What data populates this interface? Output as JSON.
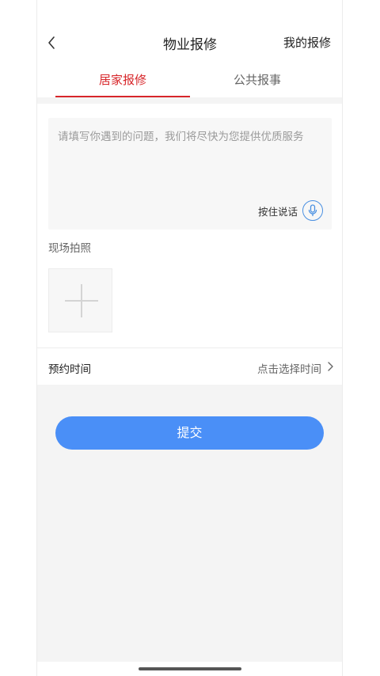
{
  "header": {
    "title": "物业报修",
    "action_label": "我的报修"
  },
  "tabs": [
    {
      "label": "居家报修",
      "active": true
    },
    {
      "label": "公共报事",
      "active": false
    }
  ],
  "form": {
    "description_placeholder": "请填写你遇到的问题，我们将尽快为您提供优质服务",
    "voice_label": "按住说话",
    "photo_label": "现场拍照",
    "appointment_label": "预约时间",
    "appointment_value": "点击选择时间",
    "submit_label": "提交"
  },
  "colors": {
    "accent_red": "#d7262a",
    "primary_blue": "#4a8ff7"
  },
  "icons": {
    "back": "chevron-left-icon",
    "mic": "microphone-icon",
    "add_photo": "plus-icon",
    "row_chevron": "chevron-right-icon"
  }
}
